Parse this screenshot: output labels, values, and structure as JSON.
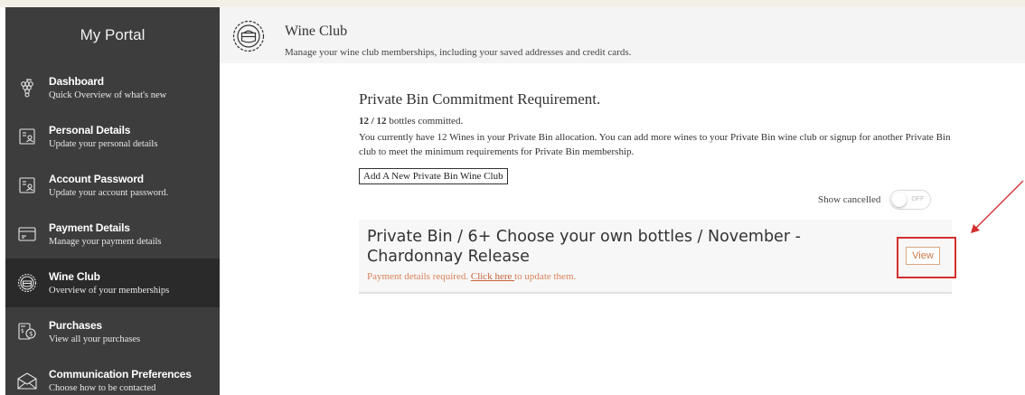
{
  "portal_title": "My Portal",
  "sidebar": {
    "items": [
      {
        "icon": "grapes-icon",
        "title": "Dashboard",
        "sub": "Quick Overview of what's new"
      },
      {
        "icon": "id-card-icon",
        "title": "Personal Details",
        "sub": "Update your personal details"
      },
      {
        "icon": "id-card-icon",
        "title": "Account Password",
        "sub": "Update your account password."
      },
      {
        "icon": "credit-card-icon",
        "title": "Payment Details",
        "sub": "Manage your payment details"
      },
      {
        "icon": "wine-club-icon",
        "title": "Wine Club",
        "sub": "Overview of your memberships",
        "active": true
      },
      {
        "icon": "receipt-icon",
        "title": "Purchases",
        "sub": "View all your purchases"
      },
      {
        "icon": "envelope-icon",
        "title": "Communication Preferences",
        "sub": "Choose how to be contacted"
      }
    ]
  },
  "header": {
    "title": "Wine Club",
    "subtitle": "Manage your wine club memberships, including your saved addresses and credit cards."
  },
  "main": {
    "section_title": "Private Bin Commitment Requirement.",
    "commit_count": "12 / 12",
    "commit_suffix": " bottles committed.",
    "description": "You currently have 12 Wines in your Private Bin allocation. You can add more wines to your Private Bin wine club or signup for another Private Bin club to meet the minimum requirements for Private Bin membership.",
    "add_button": "Add A New Private Bin Wine Club",
    "show_cancelled_label": "Show cancelled",
    "toggle_label": "OFF"
  },
  "card": {
    "title": "Private Bin / 6+ Choose your own bottles / November - Chardonnay Release",
    "note_prefix": "Payment details required. ",
    "note_link": "Click here ",
    "note_suffix": "to update them.",
    "view_button": "View"
  },
  "colors": {
    "sidebar_bg": "#3d3d3d",
    "sidebar_active": "#2a2a2a",
    "accent": "#c8784a",
    "annotation": "#d32f2f"
  }
}
